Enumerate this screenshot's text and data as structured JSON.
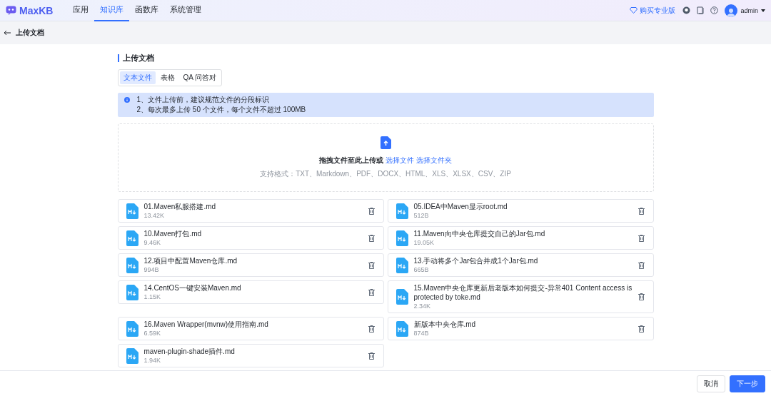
{
  "header": {
    "logo": "MaxKB",
    "nav": [
      {
        "label": "应用",
        "selected": false
      },
      {
        "label": "知识库",
        "selected": true
      },
      {
        "label": "函数库",
        "selected": false
      },
      {
        "label": "系统管理",
        "selected": false
      }
    ],
    "upgrade": "购买专业版",
    "user": "admin"
  },
  "subheader": {
    "title": "上传文档"
  },
  "section": {
    "title": "上传文档"
  },
  "tabs": [
    {
      "label": "文本文件",
      "selected": true
    },
    {
      "label": "表格",
      "selected": false
    },
    {
      "label": "QA 问答对",
      "selected": false
    }
  ],
  "notice": [
    "1、文件上传前，建议规范文件的分段标识",
    "2、每次最多上传 50 个文件，每个文件不超过 100MB"
  ],
  "dropzone": {
    "prompt": "拖拽文件至此上传或",
    "link_file": "选择文件",
    "link_folder": "选择文件夹",
    "formats": "支持格式：TXT、Markdown、PDF、DOCX、HTML、XLS、XLSX、CSV、ZIP"
  },
  "files": [
    {
      "name": "01.Maven私服搭建.md",
      "size": "13.42K"
    },
    {
      "name": "05.IDEA中Maven显示root.md",
      "size": "512B"
    },
    {
      "name": "10.Maven打包.md",
      "size": "9.46K"
    },
    {
      "name": "11.Maven向中央仓库提交自己的Jar包.md",
      "size": "19.05K"
    },
    {
      "name": "12.项目中配置Maven仓库.md",
      "size": "994B"
    },
    {
      "name": "13.手动将多个Jar包合并成1个Jar包.md",
      "size": "665B"
    },
    {
      "name": "14.CentOS一键安装Maven.md",
      "size": "1.15K"
    },
    {
      "name": "15.Maven中央仓库更新后老版本如何提交-异常401 Content access is protected by toke.md",
      "size": "2.34K"
    },
    {
      "name": "16.Maven Wrapper(mvnw)使用指南.md",
      "size": "6.59K"
    },
    {
      "name": "新版本中央仓库.md",
      "size": "874B"
    },
    {
      "name": "maven-plugin-shade插件.md",
      "size": "1.94K"
    }
  ],
  "footer": {
    "cancel": "取消",
    "next": "下一步"
  }
}
